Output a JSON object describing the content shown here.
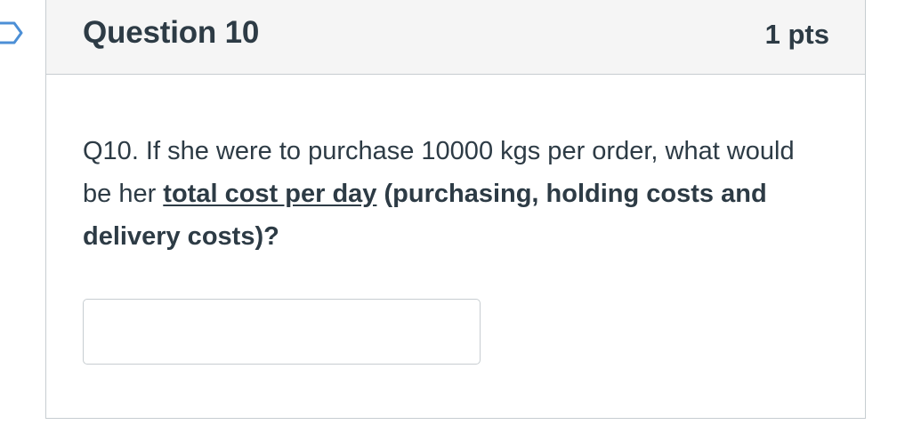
{
  "question": {
    "title": "Question 10",
    "points": "1 pts",
    "text_plain_1": "Q10. If she were to purchase 10000 kgs per order, what would be her ",
    "text_underlined": "total cost per day",
    "text_bold_2": " (purchasing, holding costs and delivery costs)?",
    "answer_value": "",
    "answer_placeholder": ""
  },
  "colors": {
    "header_background": "#f5f5f5",
    "border": "#c7cdd1",
    "text": "#2d3b45"
  },
  "icons": {
    "flag": "flag-question-icon"
  }
}
